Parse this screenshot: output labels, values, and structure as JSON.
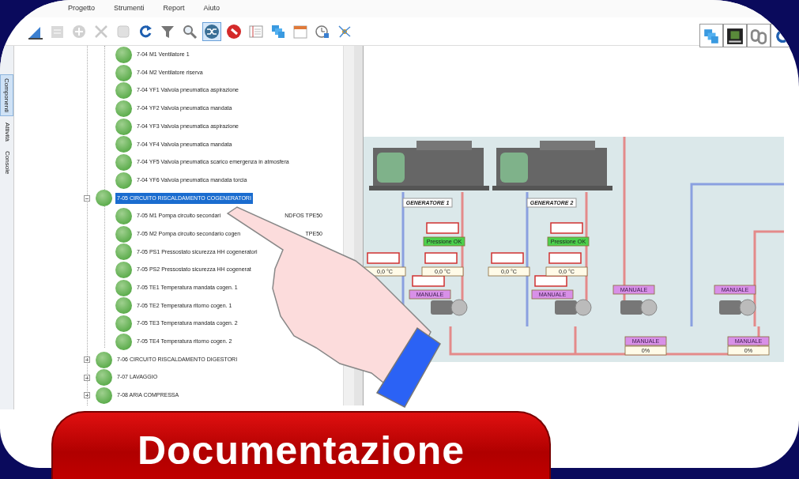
{
  "menu": [
    "Progetto",
    "Strumenti",
    "Report",
    "Aiuto"
  ],
  "toolbar": [
    {
      "kind": "setsquare",
      "disabled": false,
      "selected": false
    },
    {
      "kind": "edit",
      "disabled": true,
      "selected": false
    },
    {
      "kind": "add",
      "disabled": true,
      "selected": false
    },
    {
      "kind": "delete",
      "disabled": true,
      "selected": false
    },
    {
      "kind": "square",
      "disabled": true,
      "selected": false
    },
    {
      "kind": "refresh",
      "disabled": false,
      "selected": false
    },
    {
      "kind": "filter",
      "disabled": false,
      "selected": false
    },
    {
      "kind": "search",
      "disabled": false,
      "selected": false
    },
    {
      "kind": "shuffle",
      "disabled": false,
      "selected": true
    },
    {
      "kind": "stop",
      "disabled": false,
      "selected": false
    },
    {
      "kind": "list",
      "disabled": false,
      "selected": false
    },
    {
      "kind": "layers",
      "disabled": false,
      "selected": false
    },
    {
      "kind": "calendar",
      "disabled": false,
      "selected": false
    },
    {
      "kind": "clock",
      "disabled": false,
      "selected": false
    },
    {
      "kind": "network",
      "disabled": false,
      "selected": false
    }
  ],
  "side_tabs": [
    {
      "label": "Componenti",
      "selected": true
    },
    {
      "label": "Attività",
      "selected": false
    },
    {
      "label": "Console",
      "selected": false
    }
  ],
  "tree": {
    "continued_children": [
      {
        "label": "7-04 M1 Ventilatore 1"
      },
      {
        "label": "7-04 M2 Ventilatore riserva"
      },
      {
        "label": "7-04 YF1 Valvola pneumatica aspirazione"
      },
      {
        "label": "7-04 YF2 Valvola pneumatica mandata"
      },
      {
        "label": "7-04 YF3 Valvola pneumatica aspirazione"
      },
      {
        "label": "7-04 YF4 Valvola pneumatica mandata"
      },
      {
        "label": "7-04 YF5 Valvola pneumatica scarico emergenza in atmosfera"
      },
      {
        "label": "7-04 YF6 Valvola pneumatica mandata torcia"
      }
    ],
    "items": [
      {
        "label": "7-05 CIRCUITO RISCALDAMENTO COGENERATORI",
        "selected": true,
        "expanded": true,
        "children": [
          {
            "label": "7-05 M1 Pompa circuito secondari",
            "label_end": "NDFOS TPE50"
          },
          {
            "label": "7-05 M2 Pompa circuito secondario cogen",
            "label_end": "TPE50"
          },
          {
            "label": "7-05 PS1 Pressostato sicurezza HH cogeneratori"
          },
          {
            "label": "7-05 PS2 Pressostato sicurezza HH cogenerat"
          },
          {
            "label": "7-05 TE1 Temperatura mandata cogen. 1"
          },
          {
            "label": "7-05 TE2 Temperatura ritorno cogen. 1"
          },
          {
            "label": "7-05 TE3 Temperatura mandata cogen. 2"
          },
          {
            "label": "7-05 TE4 Temperatura ritorno cogen. 2"
          }
        ]
      },
      {
        "label": "7-06 CIRCUITO RISCALDAMENTO DIGESTORI",
        "selected": false,
        "expanded": false
      },
      {
        "label": "7-07 LAVAGGIO",
        "selected": false,
        "expanded": false
      },
      {
        "label": "7-08 ARIA COMPRESSA",
        "selected": false,
        "expanded": false
      }
    ]
  },
  "view_toolbar": [
    {
      "kind": "layers"
    },
    {
      "kind": "photo"
    },
    {
      "kind": "chain"
    },
    {
      "kind": "refresh"
    }
  ],
  "diagram": {
    "generators": [
      "GENERATORE 1",
      "GENERATORE 2"
    ],
    "tags": [
      {
        "kind": "status",
        "text": "Pressione OK"
      },
      {
        "kind": "value",
        "text": "0,0 °C"
      },
      {
        "kind": "value",
        "text": "0,0 °C"
      },
      {
        "kind": "mode",
        "text": "MANUALE"
      },
      {
        "kind": "status",
        "text": "Pressione OK"
      },
      {
        "kind": "value",
        "text": "0,0 °C"
      },
      {
        "kind": "value",
        "text": "0,0 °C"
      },
      {
        "kind": "mode",
        "text": "MANUALE"
      },
      {
        "kind": "mode",
        "text": "MANUALE"
      },
      {
        "kind": "mode",
        "text": "MANUALE"
      },
      {
        "kind": "mode",
        "text": "MANUALE"
      },
      {
        "kind": "value",
        "text": "0%"
      },
      {
        "kind": "mode",
        "text": "MANUALE"
      },
      {
        "kind": "value",
        "text": "0%"
      }
    ]
  },
  "banner_button": "Documentazione"
}
